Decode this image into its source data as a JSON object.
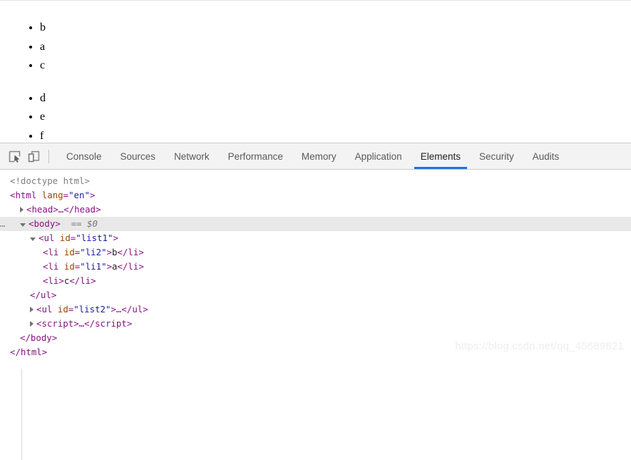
{
  "page": {
    "lists": [
      {
        "id": "list1",
        "items": [
          "b",
          "a",
          "c"
        ]
      },
      {
        "id": "list2",
        "items": [
          "d",
          "e",
          "f"
        ]
      }
    ]
  },
  "devtools": {
    "icons": {
      "inspect": "inspect-element-icon",
      "device": "device-toolbar-icon"
    },
    "tabs": [
      {
        "label": "Console",
        "active": false
      },
      {
        "label": "Sources",
        "active": false
      },
      {
        "label": "Network",
        "active": false
      },
      {
        "label": "Performance",
        "active": false
      },
      {
        "label": "Memory",
        "active": false
      },
      {
        "label": "Application",
        "active": false
      },
      {
        "label": "Elements",
        "active": true
      },
      {
        "label": "Security",
        "active": false
      },
      {
        "label": "Audits",
        "active": false
      }
    ],
    "accent_color": "#1a73e8",
    "dom": {
      "doctype": "<!doctype html>",
      "html_open_lt": "<",
      "html_tag": "html",
      "html_space": " ",
      "html_attr": "lang",
      "html_eq": "=",
      "html_value": "\"en\"",
      "html_gt": ">",
      "head_line": "<head>…</head>",
      "head_lt": "<",
      "head_tag": "head",
      "head_mid": ">…</",
      "head_close_tag": "head",
      "head_gt": ">",
      "body_ellipsis": "…",
      "body_lt": "<",
      "body_tag": "body",
      "body_gt": ">",
      "body_ref": "== $0",
      "ul1_lt": "<",
      "ul1_tag": "ul",
      "ul1_attr": "id",
      "ul1_value": "\"list1\"",
      "ul1_gt": ">",
      "li1_lt": "<",
      "li1_tag": "li",
      "li1_attr": "id",
      "li1_value": "\"li2\"",
      "li1_gt": ">",
      "li1_text": "b",
      "li1_close": "</li>",
      "li2_lt": "<",
      "li2_tag": "li",
      "li2_attr": "id",
      "li2_value": "\"li1\"",
      "li2_gt": ">",
      "li2_text": "a",
      "li2_close": "</li>",
      "li3_open": "<li>",
      "li3_text": "c",
      "li3_close": "</li>",
      "ul1_close": "</ul>",
      "ul2_lt": "<",
      "ul2_tag": "ul",
      "ul2_attr": "id",
      "ul2_value": "\"list2\"",
      "ul2_mid": ">…</",
      "ul2_close_tag": "ul",
      "ul2_gt": ">",
      "script_lt": "<",
      "script_tag": "script",
      "script_mid": ">…</",
      "script_close_tag": "script",
      "script_gt": ">",
      "body_close": "</body>",
      "html_close": "</html>"
    }
  },
  "watermark": {
    "text": "https://blog.csdn.net/qq_45689821"
  }
}
